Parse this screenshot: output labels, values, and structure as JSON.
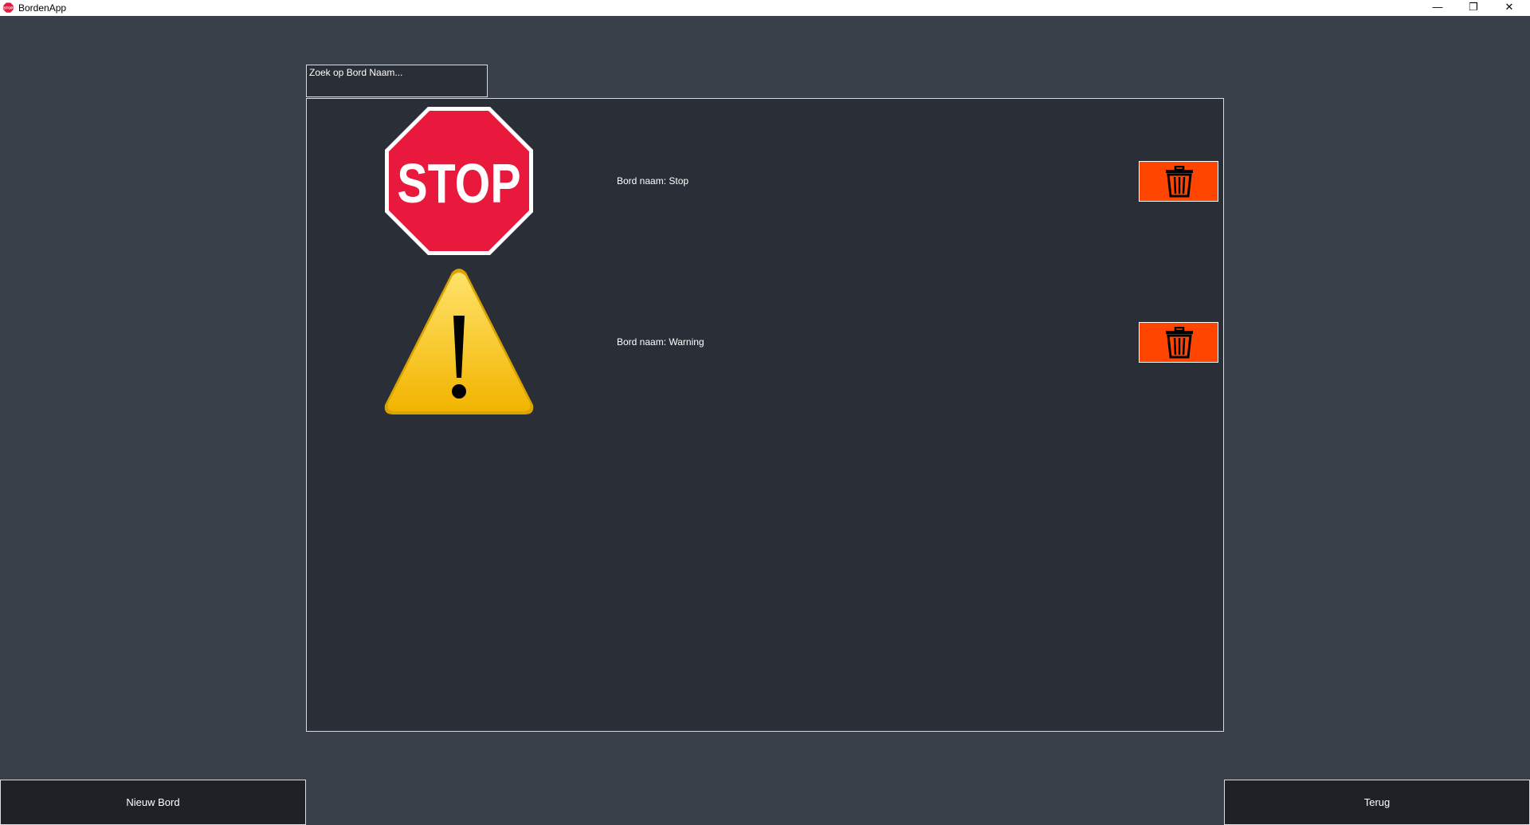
{
  "window": {
    "title": "BordenApp",
    "icon": "stop-sign-icon",
    "controls": {
      "minimize": "—",
      "maximize": "❐",
      "close": "✕"
    }
  },
  "search": {
    "placeholder": "Zoek op Bord Naam..."
  },
  "signs": [
    {
      "label": "Bord naam: Stop",
      "icon": "stop-sign-icon",
      "sign_text": "STOP"
    },
    {
      "label": "Bord naam: Warning",
      "icon": "warning-sign-icon"
    }
  ],
  "buttons": {
    "new_board": "Nieuw Bord",
    "back": "Terug"
  },
  "colors": {
    "background": "#3a4049",
    "panel": "#2a2e36",
    "delete": "#ff4500",
    "stop_red": "#e8193c",
    "warning_yellow": "#f7c600",
    "bottom_button": "#1f2126"
  }
}
